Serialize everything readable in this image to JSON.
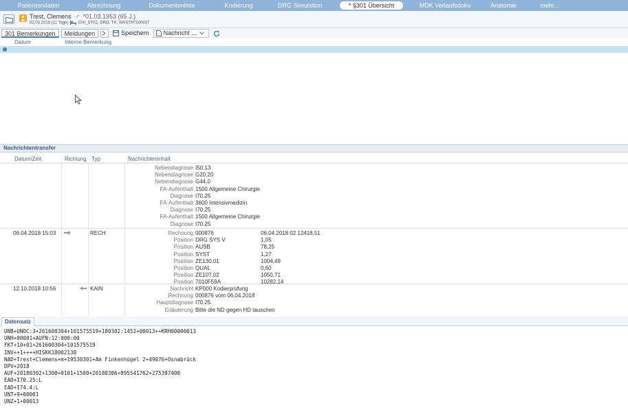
{
  "nav": {
    "tabs": [
      {
        "label": "Patientendaten"
      },
      {
        "label": "Abrechnung"
      },
      {
        "label": "Dokumentenliste"
      },
      {
        "label": "Kodierung"
      },
      {
        "label": "DRG Simulation"
      },
      {
        "label": "* §301 Übersicht"
      },
      {
        "label": "MDK Verlaufsdoku"
      },
      {
        "label": "Anatomie"
      },
      {
        "label": "mehr..."
      }
    ],
    "active_index": 5
  },
  "patient": {
    "name": "Trest, Clemens",
    "gender_symbol": "♂",
    "dob": "*01.03.1953 (65 J.)",
    "stay": "02.03.2018 (11 Tage)",
    "ward": "CHI_ST02, DRG, TK, WASTATSONST"
  },
  "toolbar": {
    "tab_bemerkungen": "301 Bemerkungen",
    "tab_meldungen": "Meldungen",
    "save_label": "Speichern",
    "message_label": "Nachricht ..."
  },
  "bemerkungen": {
    "columns": [
      "Datum",
      "Interne Bemerkung"
    ]
  },
  "transfer": {
    "title": "Nachrichtentransfer",
    "columns": [
      "Datum/Zeit",
      "Richtung",
      "Typ",
      "Nachrichteninhalt"
    ],
    "row0": {
      "lines": [
        {
          "k": "Nebendiagnose",
          "v": "I50.13"
        },
        {
          "k": "Nebendiagnose",
          "v": "G20.20"
        },
        {
          "k": "Nebendiagnose",
          "v": "G44.0"
        },
        {
          "k": "FA-Aufenthalt",
          "v": "1500 Allgemeine Chirurgie"
        },
        {
          "k": "Diagnose",
          "v": "I70.25"
        },
        {
          "k": "FA-Aufenthalt",
          "v": "3600 Intensivmedizin"
        },
        {
          "k": "Diagnose",
          "v": "I70.25"
        },
        {
          "k": "FA-Aufenthalt",
          "v": "1500 Allgemeine Chirurgie"
        },
        {
          "k": "Diagnose",
          "v": "I70.25"
        }
      ]
    },
    "row1": {
      "datetime": "06.04.2018 15:03",
      "type": "RECH",
      "lines": [
        {
          "k": "Rechnung",
          "v": "000876",
          "v2": "06.04.2018 02 12418,51"
        },
        {
          "k": "Position",
          "v": "DRG SYS V",
          "v2": "1,05"
        },
        {
          "k": "Position",
          "v": "AUSB",
          "v2": "78,25"
        },
        {
          "k": "Position",
          "v": "SYST",
          "v2": "1,27"
        },
        {
          "k": "Position",
          "v": "ZE130.01",
          "v2": "1004,49"
        },
        {
          "k": "Position",
          "v": "QUAL",
          "v2": "0,60"
        },
        {
          "k": "Position",
          "v": "ZE107.02",
          "v2": "1050,71"
        },
        {
          "k": "Position",
          "v": "7010F59A",
          "v2": "10282,14"
        }
      ]
    },
    "row2": {
      "datetime": "12.10.2018 10:56",
      "type": "KAIN",
      "lines": [
        {
          "k": "Nachricht",
          "v": "KP000 Kodierprüfung"
        },
        {
          "k": "Rechnung",
          "v": "000876 vom 06.04.2018"
        },
        {
          "k": "Hauptdiagnose",
          "v": "I70.25"
        },
        {
          "k": "Erläuterung",
          "v": "Bitte die ND gegen HD tauschen"
        }
      ]
    }
  },
  "datensatz": {
    "tab": "Datensatz",
    "lines": [
      "UNB+UNOC:3+261600304+101575519+180302:1452+00013++KRH00000013",
      "UNH+00001+AUFN:12:000:00",
      "FKT+10+01+261600304+101575519",
      "INV++1++++HISKK18002138",
      "NAD+Trest+Clemens+m+19530301+Am Finkenhügel 2+49076+Osnabrück",
      "DPV+2018",
      "AUF+20180302+1300+0101+1500+20180306+895541762+275397400",
      "EAD+I70.25:L",
      "EAD+I74.4:L",
      "UNT+9+00001",
      "UNZ+1+00013"
    ]
  },
  "colors": {
    "nav_bg": "#8fb3d9",
    "selection": "#c8e2f4",
    "accent": "#345b85",
    "patient_badge": "#f2a52b"
  }
}
